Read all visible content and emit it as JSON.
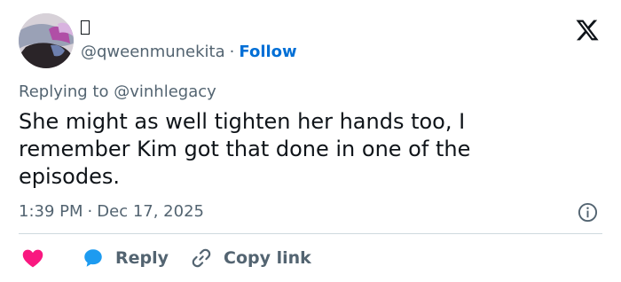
{
  "tweet": {
    "display_name": "",
    "handle": "@qweenmunekita",
    "separator": "·",
    "follow_label": "Follow",
    "reply_prefix": "Replying to",
    "reply_mention": "@vinhlegacy",
    "text": "She might as well tighten her hands too, I remember Kim got that done in one of the episodes.",
    "time": "1:39 PM",
    "date": "Dec 17, 2025"
  },
  "actions": {
    "reply_label": "Reply",
    "copy_label": "Copy link"
  },
  "icons": {
    "brand": "x-logo-icon",
    "info": "info-icon",
    "like": "heart-icon",
    "reply": "speech-bubble-icon",
    "copy": "link-icon"
  },
  "colors": {
    "follow": "#006fd6",
    "like": "#f91880",
    "reply": "#1d9bf0",
    "secondary_text": "#536471"
  }
}
